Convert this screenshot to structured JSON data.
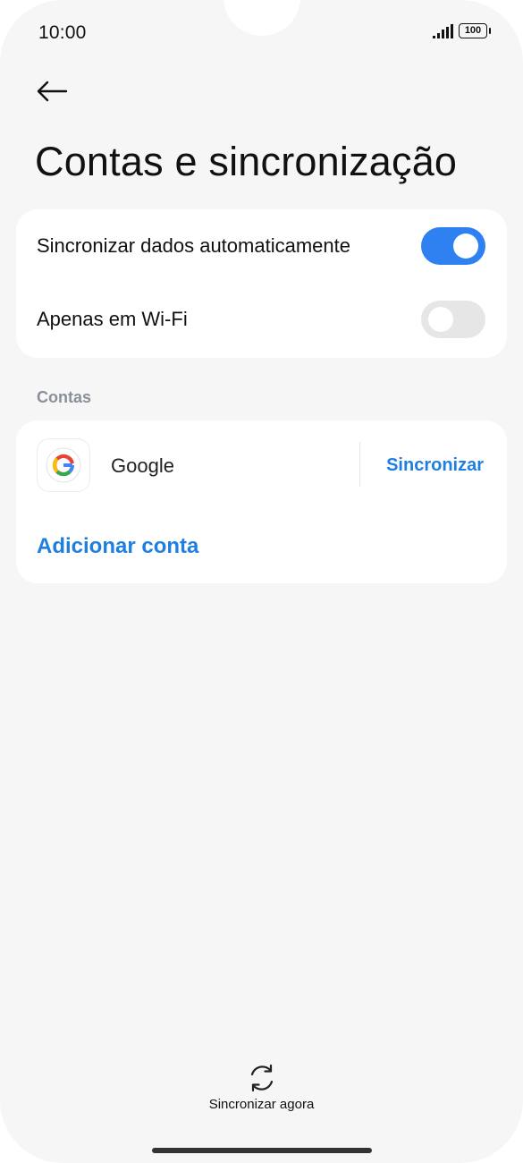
{
  "status_bar": {
    "time": "10:00",
    "battery": "100",
    "signal_icon": "cellular-signal-icon",
    "battery_icon": "battery-icon"
  },
  "header": {
    "back_icon": "arrow-left-icon",
    "title": "Contas e sincronização"
  },
  "sync_settings": {
    "auto_sync_label": "Sincronizar dados automaticamente",
    "auto_sync_enabled": true,
    "wifi_only_label": "Apenas em Wi-Fi",
    "wifi_only_enabled": false
  },
  "accounts_section": {
    "heading": "Contas",
    "accounts": [
      {
        "name": "Google",
        "icon": "google-logo-icon",
        "action_label": "Sincronizar"
      }
    ],
    "add_account_label": "Adicionar conta"
  },
  "footer": {
    "sync_now_icon": "sync-refresh-icon",
    "sync_now_label": "Sincronizar agora"
  },
  "colors": {
    "accent": "#1f7fe0",
    "toggle_on": "#2f80f0",
    "toggle_off": "#e6e6e6",
    "background": "#f6f6f6",
    "card": "#ffffff"
  }
}
